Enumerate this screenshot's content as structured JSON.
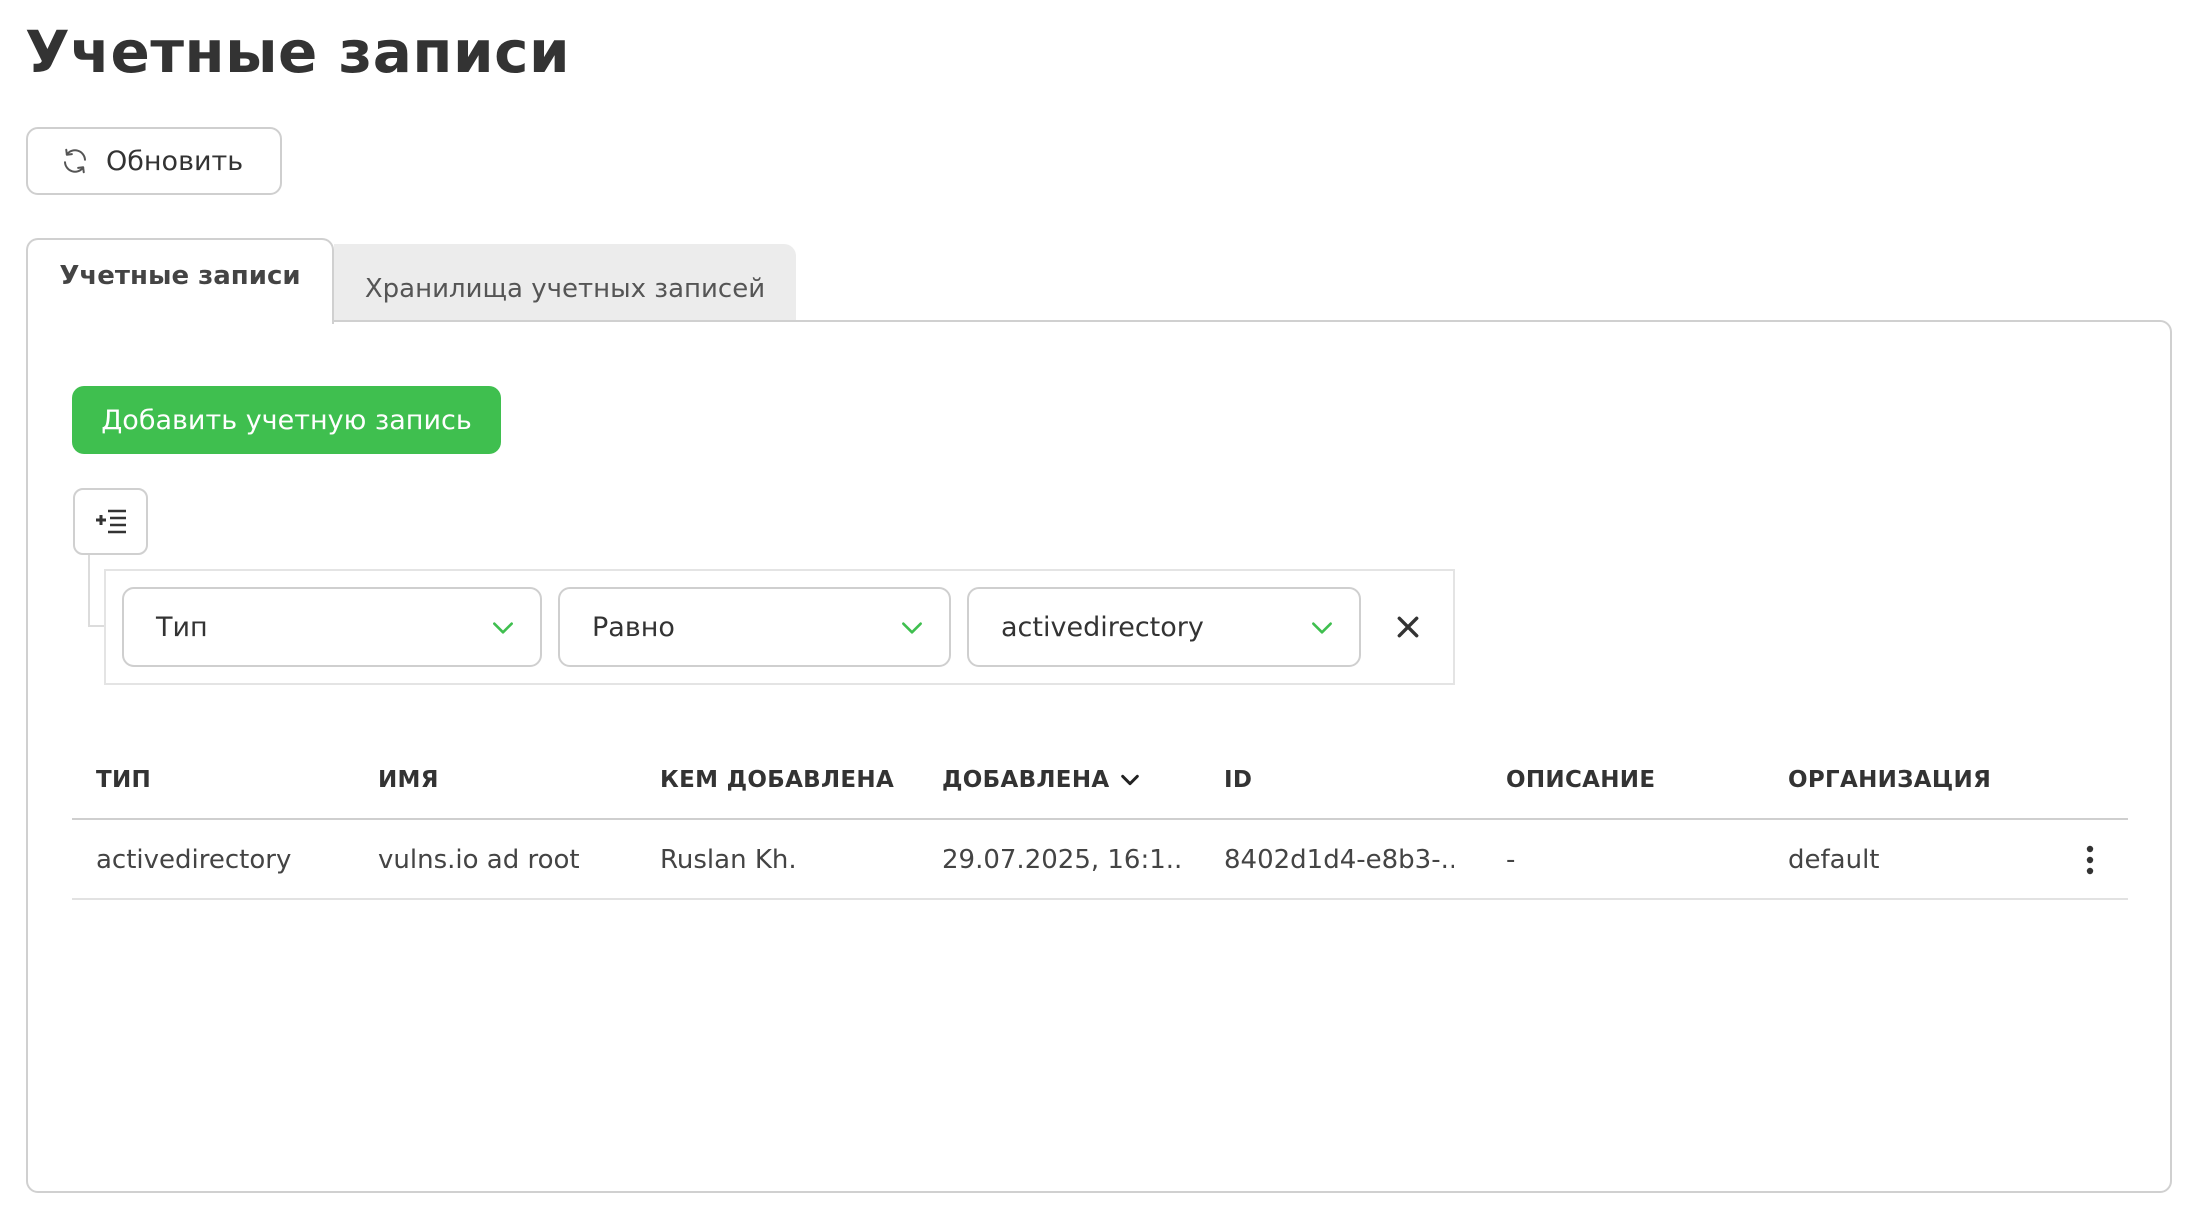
{
  "page": {
    "title": "Учетные записи",
    "refresh_label": "Обновить"
  },
  "tabs": [
    {
      "label": "Учетные записи",
      "active": true
    },
    {
      "label": "Хранилища учетных записей",
      "active": false
    }
  ],
  "actions": {
    "add_account_label": "Добавить учетную запись"
  },
  "filter": {
    "field": "Тип",
    "operator": "Равно",
    "value": "activedirectory"
  },
  "table": {
    "columns": [
      "ТИП",
      "ИМЯ",
      "КЕМ ДОБАВЛЕНА",
      "ДОБАВЛЕНА",
      "ID",
      "ОПИСАНИЕ",
      "ОРГАНИЗАЦИЯ"
    ],
    "sorted_column": "ДОБАВЛЕНА",
    "sort_direction": "desc",
    "rows": [
      {
        "type": "activedirectory",
        "name": "vulns.io ad root",
        "added_by": "Ruslan Kh.",
        "added_at": "29.07.2025, 16:1...",
        "id": "8402d1d4-e8b3-...",
        "description": "-",
        "organization": "default"
      }
    ]
  },
  "colors": {
    "accent_green": "#3fbf4f",
    "text": "#333333",
    "border": "#d0d0d0",
    "inactive_tab_bg": "#ececec"
  },
  "icons": {
    "refresh": "refresh-icon",
    "add_filter": "add-filter-icon",
    "chevron": "chevron-down-icon",
    "remove": "close-icon",
    "sort": "sort-desc-icon",
    "row_menu": "more-vertical-icon"
  }
}
